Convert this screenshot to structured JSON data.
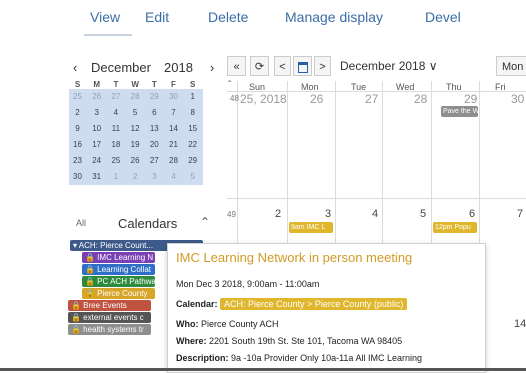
{
  "tabs": [
    "View",
    "Edit",
    "Delete",
    "Manage display",
    "Devel"
  ],
  "mini": {
    "prev_icon": "chevron-left-icon",
    "month": "December",
    "year": "2018",
    "next_icon": "chevron-right-icon",
    "weekday_labels": [
      "S",
      "M",
      "T",
      "W",
      "T",
      "F",
      "S"
    ],
    "weeks": [
      [
        "25",
        "26",
        "27",
        "28",
        "29",
        "30",
        "1"
      ],
      [
        "2",
        "3",
        "4",
        "5",
        "6",
        "7",
        "8"
      ],
      [
        "9",
        "10",
        "11",
        "12",
        "13",
        "14",
        "15"
      ],
      [
        "16",
        "17",
        "18",
        "19",
        "20",
        "21",
        "22"
      ],
      [
        "23",
        "24",
        "25",
        "26",
        "27",
        "28",
        "29"
      ],
      [
        "30",
        "31",
        "1",
        "2",
        "3",
        "4",
        "5"
      ]
    ]
  },
  "calendars": {
    "all_label": "All",
    "title": "Calendars",
    "items": [
      {
        "label": "▾ ACH: Pierce Count...",
        "color": "#3d5a8a"
      },
      {
        "label": "🔒 IMC Learning N",
        "color": "#7a3fb5"
      },
      {
        "label": "🔒 Learning Collat",
        "color": "#2f6fc7"
      },
      {
        "label": "🔒 PC ACH Pathwa",
        "color": "#2e8b3e"
      },
      {
        "label": "🔒 Pierce County",
        "color": "#d8a52b"
      },
      {
        "label": "🔒 Bree Events",
        "color": "#c0533f"
      },
      {
        "label": "🔒 external events c",
        "color": "#555555"
      },
      {
        "label": "🔒 health systems tr",
        "color": "#8e8e8e"
      }
    ]
  },
  "toolbar": {
    "double_left": "«",
    "refresh_icon": "refresh-icon",
    "prev": "<",
    "today_icon": "calendar-square-icon",
    "next": ">",
    "month_label": "December 2018 ∨",
    "view_label": "Mon"
  },
  "day_headers": [
    "Sun",
    "Mon",
    "Tue",
    "Wed",
    "Thu",
    "Fri"
  ],
  "week1": {
    "week": "48",
    "days": [
      "25, 2018",
      "26",
      "27",
      "28",
      "29",
      "30"
    ]
  },
  "week2": {
    "week": "49",
    "days": [
      "2",
      "3",
      "4",
      "5",
      "6",
      "7"
    ]
  },
  "week3": {
    "days": [
      "14"
    ]
  },
  "events": [
    {
      "label": "Pave the W",
      "color": "#8e8e8e"
    },
    {
      "label": "9am IMC L",
      "color": "#e0b62d"
    },
    {
      "label": "12pm Popu",
      "color": "#e0b62d"
    }
  ],
  "popup": {
    "title": "IMC Learning Network in person meeting",
    "date": "Mon Dec 3 2018, 9:00am - 11:00am",
    "calendar_label": "Calendar:",
    "calendar_value": "ACH: Pierce County > Pierce County (public)",
    "who_label": "Who:",
    "who_value": "Pierce County ACH",
    "where_label": "Where:",
    "where_value": "2201 South 19th St. Ste 101, Tacoma WA 98405",
    "desc_label": "Description:",
    "desc_value": "9a -10a Provider Only  10a-11a All IMC Learning"
  }
}
